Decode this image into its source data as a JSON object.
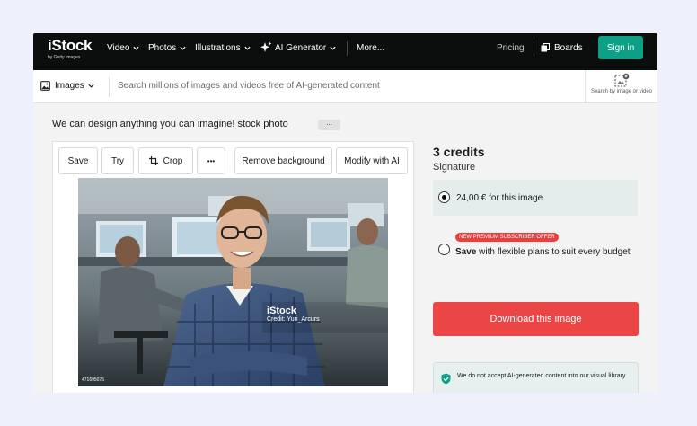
{
  "nav": {
    "logo": "iStock",
    "logo_sub": "by Getty Images",
    "items": [
      "Video",
      "Photos",
      "Illustrations",
      "AI Generator",
      "More..."
    ],
    "pricing": "Pricing",
    "boards": "Boards",
    "signin": "Sign in"
  },
  "search": {
    "type": "Images",
    "placeholder": "Search millions of images and videos free of AI-generated content",
    "visual_search_label": "Search by image or video"
  },
  "asset": {
    "title": "We can design anything you can imagine! stock photo",
    "more": "...",
    "watermark_logo": "iStock",
    "watermark_credit": "Credit: Yuri_Arcurs",
    "asset_id": "471695075"
  },
  "toolbar": {
    "save": "Save",
    "try": "Try",
    "crop": "Crop",
    "more": "•••",
    "remove_background": "Remove background",
    "modify_with_ai": "Modify with AI"
  },
  "purchase": {
    "credits": "3 credits",
    "tier": "Signature",
    "option1": "24,00 € for this image",
    "offer_badge": "NEW PREMIUM SUBSCRIBER OFFER",
    "option2_bold": "Save",
    "option2_rest": " with flexible plans to suit every budget",
    "download": "Download this image",
    "notice": "We do not accept AI-generated content into our visual library"
  },
  "colors": {
    "nav_bg": "#0c0d0d",
    "signin": "#0e9f87",
    "download": "#eb4545",
    "offer_badge": "#ee3d3d",
    "selected_option_bg": "#e4ecec"
  }
}
